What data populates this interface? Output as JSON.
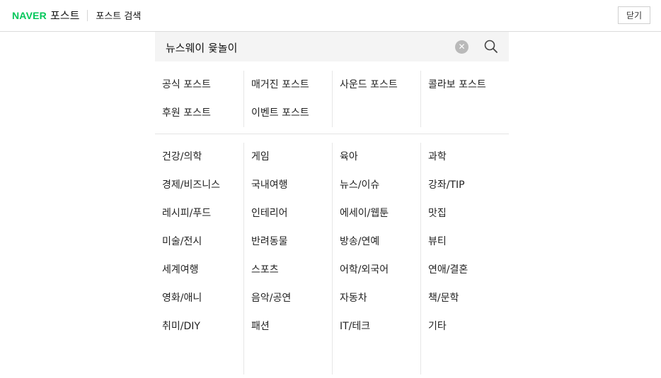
{
  "header": {
    "brand": "NAVER",
    "brand_service": "포스트",
    "title": "포스트 검색",
    "close_label": "닫기"
  },
  "search": {
    "value": "뉴스웨이 윷놀이",
    "clear_icon": "clear-icon",
    "search_icon": "search-icon"
  },
  "post_types": [
    {
      "label": "공식 포스트"
    },
    {
      "label": "매거진 포스트"
    },
    {
      "label": "사운드 포스트"
    },
    {
      "label": "콜라보 포스트"
    },
    {
      "label": "후원 포스트"
    },
    {
      "label": "이벤트 포스트"
    }
  ],
  "topics": [
    {
      "label": "건강/의학"
    },
    {
      "label": "게임"
    },
    {
      "label": "육아"
    },
    {
      "label": "과학"
    },
    {
      "label": "경제/비즈니스"
    },
    {
      "label": "국내여행"
    },
    {
      "label": "뉴스/이슈"
    },
    {
      "label": "강좌/TIP"
    },
    {
      "label": "레시피/푸드"
    },
    {
      "label": "인테리어"
    },
    {
      "label": "에세이/웹툰"
    },
    {
      "label": "맛집"
    },
    {
      "label": "미술/전시"
    },
    {
      "label": "반려동물"
    },
    {
      "label": "방송/연예"
    },
    {
      "label": "뷰티"
    },
    {
      "label": "세계여행"
    },
    {
      "label": "스포츠"
    },
    {
      "label": "어학/외국어"
    },
    {
      "label": "연애/결혼"
    },
    {
      "label": "영화/애니"
    },
    {
      "label": "음악/공연"
    },
    {
      "label": "자동차"
    },
    {
      "label": "책/문학"
    },
    {
      "label": "취미/DIY"
    },
    {
      "label": "패션"
    },
    {
      "label": "IT/테크"
    },
    {
      "label": "기타"
    }
  ],
  "colors": {
    "brand_green": "#03c75a",
    "search_bg": "#f4f4f4",
    "divider": "#e6e6e6"
  }
}
